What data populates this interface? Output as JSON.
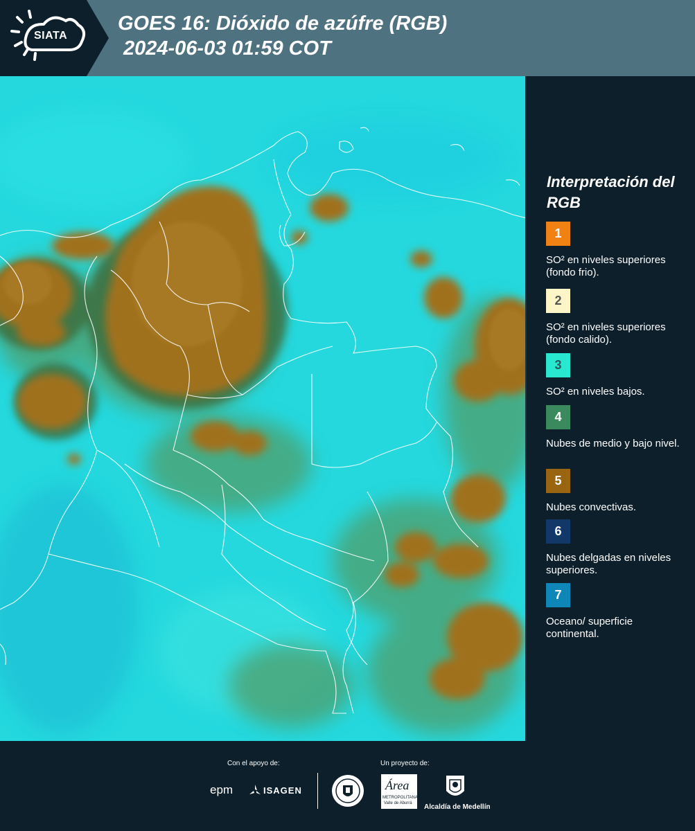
{
  "header": {
    "logo_text": "SIATA",
    "title_line1": "GOES 16: Dióxido de azúfre (RGB)",
    "title_line2": "2024-06-03 01:59 COT"
  },
  "legend": {
    "title": "Interpretación del RGB",
    "items": [
      {
        "number": "1",
        "color": "#f08214",
        "number_color": "#ffffff",
        "text": "SO² en niveles superiores (fondo frio)."
      },
      {
        "number": "2",
        "color": "#fbf5c7",
        "number_color": "#555555",
        "text": "SO² en niveles superiores (fondo calido)."
      },
      {
        "number": "3",
        "color": "#28e8d0",
        "number_color": "#2a5a60",
        "text": "SO² en niveles bajos."
      },
      {
        "number": "4",
        "color": "#3a8a5e",
        "number_color": "#ffffff",
        "text": "Nubes de medio y bajo nivel."
      },
      {
        "number": "5",
        "color": "#9a6510",
        "number_color": "#ffffff",
        "text": "Nubes convectivas."
      },
      {
        "number": "6",
        "color": "#123868",
        "number_color": "#ffffff",
        "text": "Nubes delgadas en niveles superiores."
      },
      {
        "number": "7",
        "color": "#0f86b8",
        "number_color": "#ffffff",
        "text": "Oceano/ superficie continental."
      }
    ]
  },
  "footer": {
    "support_label": "Con el apoyo de:",
    "project_label": "Un proyecto de:",
    "epm": "epm",
    "isagen": "ISAGEN",
    "area_name": "Área",
    "area_sub1": "METROPOLITANA",
    "area_sub2": "Valle de Aburrá",
    "alcaldia": "Alcaldía de Medellín"
  },
  "colors": {
    "header_bg": "#4f7280",
    "panel_bg": "#0d1f2b",
    "map_base": "#24d8de",
    "convective": "#a0711c",
    "mid_low": "#4f9e6a"
  }
}
